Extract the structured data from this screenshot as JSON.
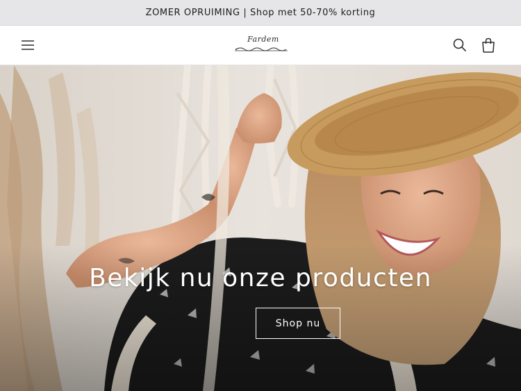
{
  "announcement": {
    "text": "ZOMER OPRUIMING | Shop met 50-70% korting"
  },
  "header": {
    "logo_text": "Fardem",
    "menu_icon": "hamburger-menu-icon",
    "search_icon": "search-icon",
    "cart_icon": "shopping-bag-icon"
  },
  "hero": {
    "heading": "Bekijk nu onze producten",
    "button_label": "Shop nu"
  },
  "colors": {
    "announcement_bg": "#e6e6e8",
    "header_bg": "#ffffff",
    "hero_text": "#ffffff"
  }
}
